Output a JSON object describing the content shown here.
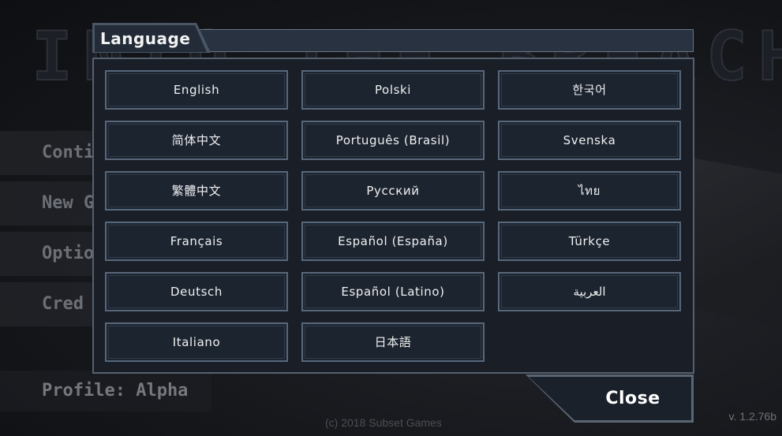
{
  "background": {
    "game_title": "INTO THE BREACH",
    "menu_items": [
      "Conti",
      "New G",
      "Optio",
      "Cred"
    ],
    "profile_label": "Profile: Alpha",
    "copyright": "(c) 2018 Subset Games",
    "version": "v. 1.2.76b"
  },
  "dialog": {
    "title": "Language",
    "languages": [
      "English",
      "Polski",
      "한국어",
      "简体中文",
      "Português (Brasil)",
      "Svenska",
      "繁體中文",
      "Русский",
      "ไทย",
      "Français",
      "Español (España)",
      "Türkçe",
      "Deutsch",
      "Español (Latino)",
      "العربية",
      "Italiano",
      "日本語"
    ],
    "close_label": "Close"
  },
  "colors": {
    "panel_bg": "#1a1f27",
    "button_bg": "#1c2430",
    "button_border": "#58677a",
    "text": "#f0f0f0"
  }
}
